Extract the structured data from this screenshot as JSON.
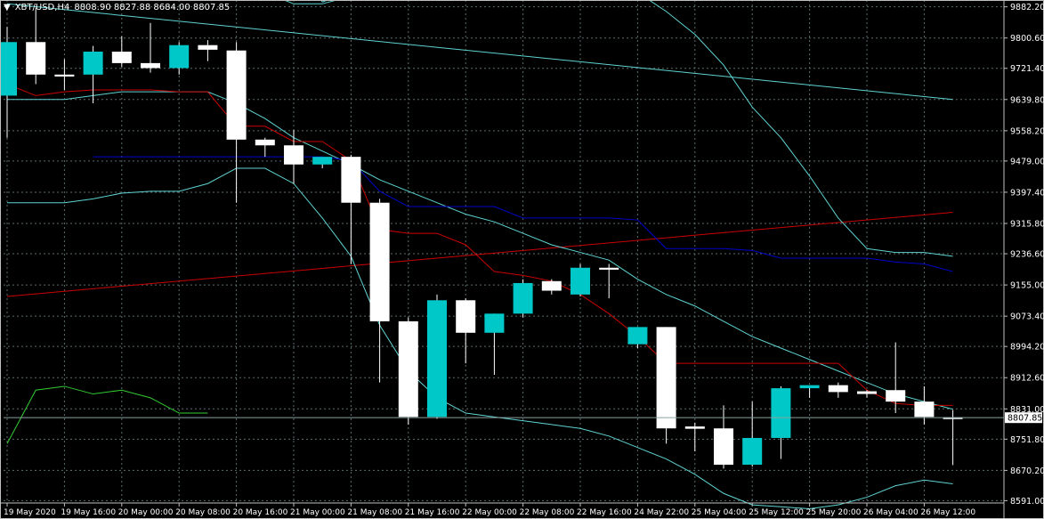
{
  "header": {
    "symbol": "XBT/USD,H4",
    "ohlc": "8808.90 8827.88 8684.00 8807.85"
  },
  "colors": {
    "background": "#000000",
    "grid": "#5a6e6e",
    "axis": "#c0c0c0",
    "text": "#ffffff",
    "bull": "#00c8c8",
    "bear": "#ffffff",
    "red_line": "#cc0000",
    "blue_line": "#0000cc",
    "cyan_line": "#5fd3d3",
    "green_line": "#33cc33"
  },
  "chart_data": {
    "type": "candlestick",
    "y_ticks": [
      "9882.20",
      "9800.60",
      "9721.40",
      "9639.80",
      "9558.20",
      "9479.00",
      "9397.40",
      "9315.80",
      "9236.60",
      "9155.00",
      "9073.40",
      "8994.20",
      "8912.60",
      "8831.00",
      "8751.80",
      "8670.20",
      "8591.00"
    ],
    "x_ticks": [
      "19 May 2020",
      "19 May 16:00",
      "20 May 00:00",
      "20 May 08:00",
      "20 May 16:00",
      "21 May 00:00",
      "21 May 08:00",
      "21 May 16:00",
      "22 May 00:00",
      "22 May 08:00",
      "22 May 16:00",
      "24 May 22:00",
      "25 May 04:00",
      "25 May 12:00",
      "25 May 20:00",
      "26 May 04:00",
      "26 May 12:00"
    ],
    "current_price_label": "8807.85",
    "ylim": [
      8585,
      9900
    ],
    "candles": [
      {
        "o": 9650,
        "h": 9830,
        "l": 9540,
        "c": 9790
      },
      {
        "o": 9790,
        "h": 9880,
        "l": 9680,
        "c": 9705
      },
      {
        "o": 9705,
        "h": 9745,
        "l": 9665,
        "c": 9700
      },
      {
        "o": 9705,
        "h": 9780,
        "l": 9630,
        "c": 9765
      },
      {
        "o": 9765,
        "h": 9805,
        "l": 9725,
        "c": 9735
      },
      {
        "o": 9735,
        "h": 9840,
        "l": 9710,
        "c": 9722
      },
      {
        "o": 9722,
        "h": 9790,
        "l": 9705,
        "c": 9782
      },
      {
        "o": 9782,
        "h": 9795,
        "l": 9740,
        "c": 9770
      },
      {
        "o": 9768,
        "h": 9790,
        "l": 9370,
        "c": 9535
      },
      {
        "o": 9535,
        "h": 9540,
        "l": 9490,
        "c": 9520
      },
      {
        "o": 9520,
        "h": 9560,
        "l": 9420,
        "c": 9470
      },
      {
        "o": 9470,
        "h": 9485,
        "l": 9460,
        "c": 9490
      },
      {
        "o": 9490,
        "h": 9495,
        "l": 9210,
        "c": 9370
      },
      {
        "o": 9370,
        "h": 9380,
        "l": 8900,
        "c": 9060
      },
      {
        "o": 9060,
        "h": 9070,
        "l": 8790,
        "c": 8810
      },
      {
        "o": 8810,
        "h": 9130,
        "l": 8805,
        "c": 9115
      },
      {
        "o": 9115,
        "h": 9120,
        "l": 8950,
        "c": 9030
      },
      {
        "o": 9030,
        "h": 9080,
        "l": 8920,
        "c": 9080
      },
      {
        "o": 9080,
        "h": 9170,
        "l": 9070,
        "c": 9160
      },
      {
        "o": 9165,
        "h": 9170,
        "l": 9130,
        "c": 9140
      },
      {
        "o": 9130,
        "h": 9210,
        "l": 9125,
        "c": 9200
      },
      {
        "o": 9200,
        "h": 9210,
        "l": 9120,
        "c": 9195
      },
      {
        "o": 9000,
        "h": 9045,
        "l": 8990,
        "c": 9045
      },
      {
        "o": 9045,
        "h": 9045,
        "l": 8740,
        "c": 8780
      },
      {
        "o": 8785,
        "h": 8795,
        "l": 8720,
        "c": 8779
      },
      {
        "o": 8780,
        "h": 8840,
        "l": 8675,
        "c": 8685
      },
      {
        "o": 8685,
        "h": 8850,
        "l": 8680,
        "c": 8755
      },
      {
        "o": 8755,
        "h": 8890,
        "l": 8700,
        "c": 8885
      },
      {
        "o": 8885,
        "h": 8890,
        "l": 8860,
        "c": 8893
      },
      {
        "o": 8893,
        "h": 8900,
        "l": 8860,
        "c": 8875
      },
      {
        "o": 8877,
        "h": 8880,
        "l": 8860,
        "c": 8870
      },
      {
        "o": 8880,
        "h": 9005,
        "l": 8820,
        "c": 8850
      },
      {
        "o": 8850,
        "h": 8890,
        "l": 8790,
        "c": 8810
      },
      {
        "o": 8809,
        "h": 8828,
        "l": 8684,
        "c": 8808
      }
    ],
    "lines": {
      "red_short": [
        [
          0,
          9680
        ],
        [
          1,
          9650
        ],
        [
          2,
          9660
        ],
        [
          3,
          9665
        ],
        [
          4,
          9665
        ],
        [
          5,
          9665
        ],
        [
          6,
          9660
        ],
        [
          7,
          9660
        ],
        [
          8,
          9570
        ],
        [
          9,
          9570
        ],
        [
          10,
          9530
        ],
        [
          11,
          9530
        ],
        [
          12,
          9480
        ],
        [
          13,
          9300
        ],
        [
          14,
          9290
        ],
        [
          15,
          9290
        ],
        [
          16,
          9260
        ],
        [
          17,
          9190
        ],
        [
          18,
          9180
        ],
        [
          19,
          9165
        ],
        [
          20,
          9130
        ],
        [
          21,
          9080
        ],
        [
          22,
          9020
        ],
        [
          23,
          8950
        ],
        [
          24,
          8950
        ],
        [
          25,
          8950
        ],
        [
          26,
          8950
        ],
        [
          27,
          8950
        ],
        [
          28,
          8950
        ],
        [
          29,
          8950
        ],
        [
          30,
          8880
        ],
        [
          31,
          8845
        ],
        [
          32,
          8840
        ],
        [
          33,
          8840
        ]
      ],
      "blue": [
        [
          3,
          9490
        ],
        [
          4,
          9490
        ],
        [
          5,
          9490
        ],
        [
          6,
          9490
        ],
        [
          7,
          9490
        ],
        [
          8,
          9490
        ],
        [
          9,
          9490
        ],
        [
          10,
          9490
        ],
        [
          11,
          9490
        ],
        [
          12,
          9480
        ],
        [
          13,
          9400
        ],
        [
          14,
          9360
        ],
        [
          15,
          9360
        ],
        [
          16,
          9360
        ],
        [
          17,
          9360
        ],
        [
          18,
          9330
        ],
        [
          19,
          9330
        ],
        [
          20,
          9330
        ],
        [
          21,
          9330
        ],
        [
          22,
          9325
        ],
        [
          23,
          9250
        ],
        [
          24,
          9250
        ],
        [
          25,
          9250
        ],
        [
          26,
          9245
        ],
        [
          27,
          9225
        ],
        [
          28,
          9225
        ],
        [
          29,
          9225
        ],
        [
          30,
          9225
        ],
        [
          31,
          9215
        ],
        [
          32,
          9210
        ],
        [
          33,
          9190
        ]
      ],
      "cyan_upper": [
        [
          0,
          9990
        ],
        [
          1,
          9990
        ],
        [
          2,
          9970
        ],
        [
          3,
          9960
        ],
        [
          4,
          9950
        ],
        [
          5,
          9930
        ],
        [
          6,
          9915
        ],
        [
          7,
          9930
        ],
        [
          8,
          9935
        ],
        [
          9,
          9920
        ],
        [
          10,
          9890
        ],
        [
          11,
          9890
        ],
        [
          12,
          9910
        ],
        [
          13,
          9960
        ],
        [
          14,
          9980
        ],
        [
          15,
          9990
        ],
        [
          16,
          9990
        ],
        [
          17,
          9990
        ],
        [
          18,
          9990
        ],
        [
          19,
          9990
        ],
        [
          20,
          9990
        ],
        [
          21,
          9990
        ],
        [
          22,
          9920
        ],
        [
          23,
          9870
        ],
        [
          24,
          9810
        ],
        [
          25,
          9730
        ],
        [
          26,
          9620
        ],
        [
          27,
          9540
        ],
        [
          28,
          9440
        ],
        [
          29,
          9330
        ],
        [
          30,
          9250
        ],
        [
          31,
          9240
        ],
        [
          32,
          9240
        ],
        [
          33,
          9230
        ]
      ],
      "cyan_mid": [
        [
          0,
          9640
        ],
        [
          1,
          9640
        ],
        [
          2,
          9640
        ],
        [
          3,
          9650
        ],
        [
          4,
          9660
        ],
        [
          5,
          9660
        ],
        [
          6,
          9660
        ],
        [
          7,
          9660
        ],
        [
          8,
          9630
        ],
        [
          9,
          9590
        ],
        [
          10,
          9540
        ],
        [
          11,
          9505
        ],
        [
          12,
          9470
        ],
        [
          13,
          9430
        ],
        [
          14,
          9400
        ],
        [
          15,
          9370
        ],
        [
          16,
          9340
        ],
        [
          17,
          9320
        ],
        [
          18,
          9290
        ],
        [
          19,
          9260
        ],
        [
          20,
          9240
        ],
        [
          21,
          9220
        ],
        [
          22,
          9170
        ],
        [
          23,
          9130
        ],
        [
          24,
          9100
        ],
        [
          25,
          9060
        ],
        [
          26,
          9020
        ],
        [
          27,
          8990
        ],
        [
          28,
          8960
        ],
        [
          29,
          8930
        ],
        [
          30,
          8900
        ],
        [
          31,
          8870
        ],
        [
          32,
          8850
        ],
        [
          33,
          8830
        ]
      ],
      "cyan_lower": [
        [
          0,
          9370
        ],
        [
          1,
          9370
        ],
        [
          2,
          9370
        ],
        [
          3,
          9380
        ],
        [
          4,
          9395
        ],
        [
          5,
          9400
        ],
        [
          6,
          9400
        ],
        [
          7,
          9420
        ],
        [
          8,
          9460
        ],
        [
          9,
          9460
        ],
        [
          10,
          9420
        ],
        [
          11,
          9330
        ],
        [
          12,
          9230
        ],
        [
          13,
          9050
        ],
        [
          14,
          8930
        ],
        [
          15,
          8860
        ],
        [
          16,
          8820
        ],
        [
          17,
          8810
        ],
        [
          18,
          8800
        ],
        [
          19,
          8790
        ],
        [
          20,
          8780
        ],
        [
          21,
          8760
        ],
        [
          22,
          8730
        ],
        [
          23,
          8700
        ],
        [
          24,
          8660
        ],
        [
          25,
          8610
        ],
        [
          26,
          8580
        ],
        [
          27,
          8575
        ],
        [
          28,
          8570
        ],
        [
          29,
          8580
        ],
        [
          30,
          8600
        ],
        [
          31,
          8630
        ],
        [
          32,
          8645
        ],
        [
          33,
          8635
        ]
      ],
      "cyan_long": [
        [
          0,
          9890
        ],
        [
          33,
          9640
        ]
      ],
      "red_long": [
        [
          0,
          9125
        ],
        [
          33,
          9345
        ]
      ],
      "green": [
        [
          0,
          8740
        ],
        [
          1,
          8880
        ],
        [
          2,
          8890
        ],
        [
          3,
          8870
        ],
        [
          4,
          8880
        ],
        [
          5,
          8860
        ],
        [
          6,
          8820
        ],
        [
          7,
          8820
        ]
      ],
      "cyan_top_wiggle": [
        [
          9,
          10000
        ],
        [
          10,
          9990
        ],
        [
          11,
          9895
        ],
        [
          12,
          9920
        ],
        [
          13,
          9950
        ]
      ]
    }
  }
}
